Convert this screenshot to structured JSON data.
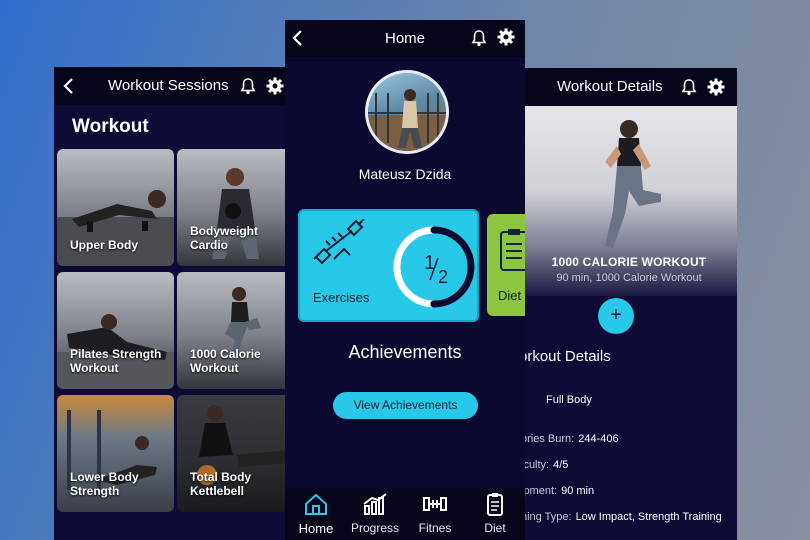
{
  "left_screen": {
    "title": "Workout Sessions",
    "section": "Workout",
    "tiles": [
      {
        "label": "Upper Body"
      },
      {
        "label": "Bodyweight Cardio"
      },
      {
        "label": "Pilates Strength Workout"
      },
      {
        "label": "1000 Calorie Workout"
      },
      {
        "label": "Lower Body Strength"
      },
      {
        "label": "Total Body Kettlebell"
      }
    ]
  },
  "center_screen": {
    "title": "Home",
    "user_name": "Mateusz Dzida",
    "exercise_card": {
      "label": "Exercises",
      "progress_num": "1",
      "progress_den": "2",
      "progress": 0.5
    },
    "diet_card": {
      "label": "Diet"
    },
    "achievements_title": "Achievements",
    "view_achievements": "View Achievements",
    "nav": [
      {
        "label": "Home",
        "icon": "home-icon"
      },
      {
        "label": "Progress",
        "icon": "chart-icon"
      },
      {
        "label": "Fitnes",
        "icon": "dumbbell-icon"
      },
      {
        "label": "Diet",
        "icon": "clipboard-icon"
      }
    ]
  },
  "right_screen": {
    "title": "Workout Details",
    "hero_title": "1000 CALORIE WORKOUT",
    "hero_subtitle": "90 min, 1000 Calorie Workout",
    "plus": "+",
    "details_title": "orkout Details",
    "details": [
      {
        "key": "",
        "value": "Full Body"
      },
      {
        "key": "ories Burn:",
        "value": "244-406"
      },
      {
        "key": "iculty:",
        "value": "4/5"
      },
      {
        "key": "ipment:",
        "value": "90 min"
      },
      {
        "key": "ning Type:",
        "value": "Low Impact, Strength Training"
      }
    ]
  },
  "colors": {
    "accent": "#28c9e8",
    "screen_bg": "#0d0b35",
    "topbar": "#06051a",
    "diet_card": "#8cc63f"
  }
}
